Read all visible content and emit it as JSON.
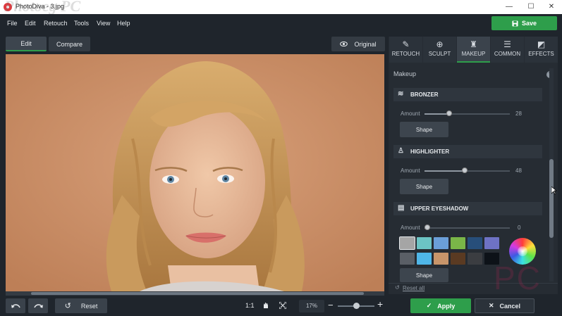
{
  "window": {
    "title": "PhotoDiva - 3.jpg",
    "watermark_top": "Photoeg PC",
    "watermark_bottom": "PC",
    "minimize": "—",
    "maximize": "☐",
    "close": "✕"
  },
  "menu": [
    "File",
    "Edit",
    "Retouch",
    "Tools",
    "View",
    "Help"
  ],
  "save_label": "Save",
  "view_tabs": {
    "edit": "Edit",
    "compare": "Compare",
    "original": "Original"
  },
  "panel_tabs": [
    {
      "label": "RETOUCH",
      "icon": "retouch-icon"
    },
    {
      "label": "SCULPT",
      "icon": "sculpt-icon"
    },
    {
      "label": "MAKEUP",
      "icon": "makeup-icon"
    },
    {
      "label": "COMMON",
      "icon": "sliders-icon"
    },
    {
      "label": "EFFECTS",
      "icon": "effects-icon"
    }
  ],
  "panel": {
    "title": "Makeup",
    "help": "?",
    "sections": [
      {
        "title": "BRONZER",
        "amount_label": "Amount",
        "value": "28",
        "level": 0.29,
        "shape": "Shape"
      },
      {
        "title": "HIGHLIGHTER",
        "amount_label": "Amount",
        "value": "48",
        "level": 0.47,
        "shape": "Shape"
      },
      {
        "title": "UPPER EYESHADOW",
        "amount_label": "Amount",
        "value": "0",
        "level": 0.03,
        "shape": "Shape"
      }
    ],
    "swatches": [
      "#a5a5a5",
      "#6cc4c4",
      "#6b9fd9",
      "#7ab648",
      "#274e7a",
      "#6e72c4",
      "#5a5f66",
      "#4fb6e8",
      "#c8956a",
      "#5a3a22",
      "#3b3d41",
      "#0d1218"
    ],
    "reset_all": "Reset all"
  },
  "bottom": {
    "reset": "Reset",
    "ratio": "1:1",
    "zoom": "17%",
    "minus": "−",
    "plus": "+",
    "zoom_level": 0.5
  },
  "apply_label": "Apply",
  "cancel_label": "Cancel",
  "colors": {
    "accent": "#2e9e4b",
    "bg": "#1f252c",
    "panel": "#262c33"
  }
}
